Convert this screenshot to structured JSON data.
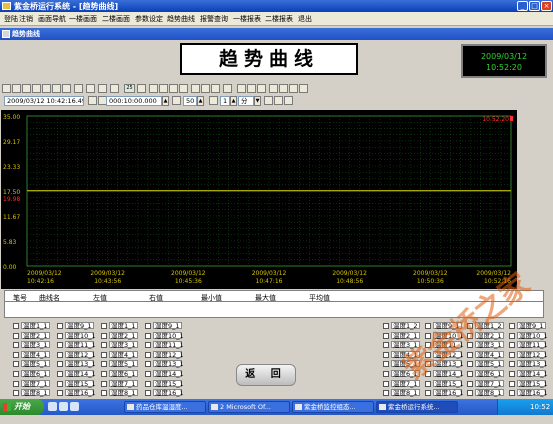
{
  "window": {
    "title": "紫金桥运行系统 - [趋势曲线]"
  },
  "menu": [
    "登陆",
    "注销",
    "画面导航",
    "一楼画面",
    "二楼画面",
    "参数设定",
    "趋势曲线",
    "报警查询",
    "一楼报表",
    "二楼报表",
    "退出"
  ],
  "inner_title": "趋势曲线",
  "page_title": "趋势曲线",
  "clock": {
    "date": "2009/03/12",
    "time": "10:52:20"
  },
  "toolbar": {
    "start_time": "2009/03/12 10:42:16.499",
    "duration": "000:10:00.000",
    "points": "50",
    "step_value": "1",
    "step_unit": "分",
    "zoom_label": "25"
  },
  "chart_data": {
    "type": "line",
    "y_ticks": [
      "35.00",
      "29.17",
      "23.33",
      "17.50",
      "11.67",
      "5.83",
      "0.00"
    ],
    "ylim": [
      0,
      35
    ],
    "x_ticks": [
      {
        "date": "2009/03/12",
        "time": "10:42:16"
      },
      {
        "date": "2009/03/12",
        "time": "10:43:56"
      },
      {
        "date": "2009/03/12",
        "time": "10:45:36"
      },
      {
        "date": "2009/03/12",
        "time": "10:47:16"
      },
      {
        "date": "2009/03/12",
        "time": "10:48:56"
      },
      {
        "date": "2009/03/12",
        "time": "10:50:36"
      },
      {
        "date": "2009/03/12",
        "time": "10:52:16"
      }
    ],
    "cursor_left_value": "19.98",
    "cursor_right_value": "10.52.20",
    "series": [
      {
        "color": "#ff3030",
        "values": [
          17.5,
          17.5,
          17.5,
          17.5,
          17.5,
          17.5,
          17.5
        ]
      },
      {
        "color": "#c0c000",
        "values": [
          17.6,
          17.6,
          17.6,
          17.6,
          17.6,
          17.6,
          17.6
        ]
      }
    ],
    "grid": true,
    "background": "#000000"
  },
  "table": {
    "headers": [
      "笔号",
      "曲线名",
      "左值",
      "右值",
      "最小值",
      "最大值",
      "平均值"
    ]
  },
  "sensors_left": [
    [
      "温度1_1",
      "温度9_1",
      "湿度1_1",
      "湿度9_1"
    ],
    [
      "温度2_1",
      "温度10_1",
      "湿度2_1",
      "湿度10_1"
    ],
    [
      "温度3_1",
      "温度11_1",
      "湿度3_1",
      "湿度11_1"
    ],
    [
      "温度4_1",
      "温度12_1",
      "湿度4_1",
      "湿度12_1"
    ],
    [
      "温度5_1",
      "温度13_1",
      "湿度5_1",
      "湿度13_1"
    ],
    [
      "温度6_1",
      "温度14_1",
      "湿度6_1",
      "湿度14_1"
    ],
    [
      "温度7_1",
      "温度15_1",
      "湿度7_1",
      "湿度15_1"
    ],
    [
      "温度8_1",
      "温度16_1",
      "湿度8_1",
      "湿度16_1"
    ]
  ],
  "sensors_right": [
    [
      "温度1_2",
      "温度9_1",
      "湿度1_2",
      "湿度9_1"
    ],
    [
      "温度2_1",
      "温度10_1",
      "湿度2_1",
      "湿度10_1"
    ],
    [
      "温度3_1",
      "温度11_1",
      "湿度3_1",
      "湿度11_1"
    ],
    [
      "温度4_1",
      "温度12_1",
      "湿度4_1",
      "湿度12_1"
    ],
    [
      "温度5_1",
      "温度13_1",
      "湿度5_1",
      "湿度13_1"
    ],
    [
      "温度6_1",
      "温度14_1",
      "湿度6_1",
      "湿度14_1"
    ],
    [
      "温度7_1",
      "温度15_1",
      "湿度7_1",
      "湿度15_1"
    ],
    [
      "温度8_1",
      "温度16_1",
      "湿度8_1",
      "湿度16_1"
    ]
  ],
  "return_button": "返 回",
  "taskbar": {
    "start": "开始",
    "tasks": [
      "药品仓库温湿度...",
      "2 Microsoft Of...",
      "紫金桥监控组态...",
      "紫金桥运行系统..."
    ],
    "time": "10:52"
  },
  "watermark": "紫金桥之家",
  "colors": {
    "titlebar": "#0a3fb8",
    "chart_bg": "#000000",
    "grid": "#2a8a2a",
    "clock_text": "#2ed42e"
  }
}
